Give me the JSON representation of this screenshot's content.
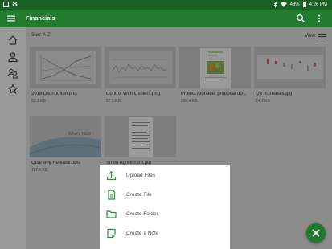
{
  "status_bar": {
    "battery": "48%",
    "time": "4:26 PM"
  },
  "app_bar": {
    "title": "Financials",
    "menu_icon": "hamburger-menu-icon",
    "search_icon": "search-icon",
    "more_icon": "more-vert-icon"
  },
  "side_rail": [
    {
      "icon": "home-icon"
    },
    {
      "icon": "person-icon"
    },
    {
      "icon": "people-icon"
    },
    {
      "icon": "star-icon"
    }
  ],
  "toolbar": {
    "sort_label": "Sort: A-Z",
    "view_label": "View"
  },
  "files": [
    {
      "name": "2018 Distribution.png",
      "size": "53.1 KB"
    },
    {
      "name": "Control With Outliers.png",
      "size": "57.5 KB"
    },
    {
      "name": "Project Alphabet proposal do...",
      "size": "296.4 KB"
    },
    {
      "name": "Q3 Increases.jpg",
      "size": "24.7 KB"
    },
    {
      "name": "Quarterly Release.pptx",
      "size": "117.5 KB"
    },
    {
      "name": "Smith Agreement.pdf",
      "size": ""
    }
  ],
  "thumb_text": {
    "slide_text": "What's NEW"
  },
  "action_sheet": [
    {
      "label": "Upload Files",
      "icon": "upload-icon"
    },
    {
      "label": "Create File",
      "icon": "file-icon"
    },
    {
      "label": "Create Folder",
      "icon": "folder-icon"
    },
    {
      "label": "Create a Note",
      "icon": "note-icon"
    }
  ],
  "colors": {
    "app_bar": "#237b30",
    "status_bar": "#1a5f24",
    "accent": "#2e8b3a",
    "scrim": "#8c8c8c"
  }
}
